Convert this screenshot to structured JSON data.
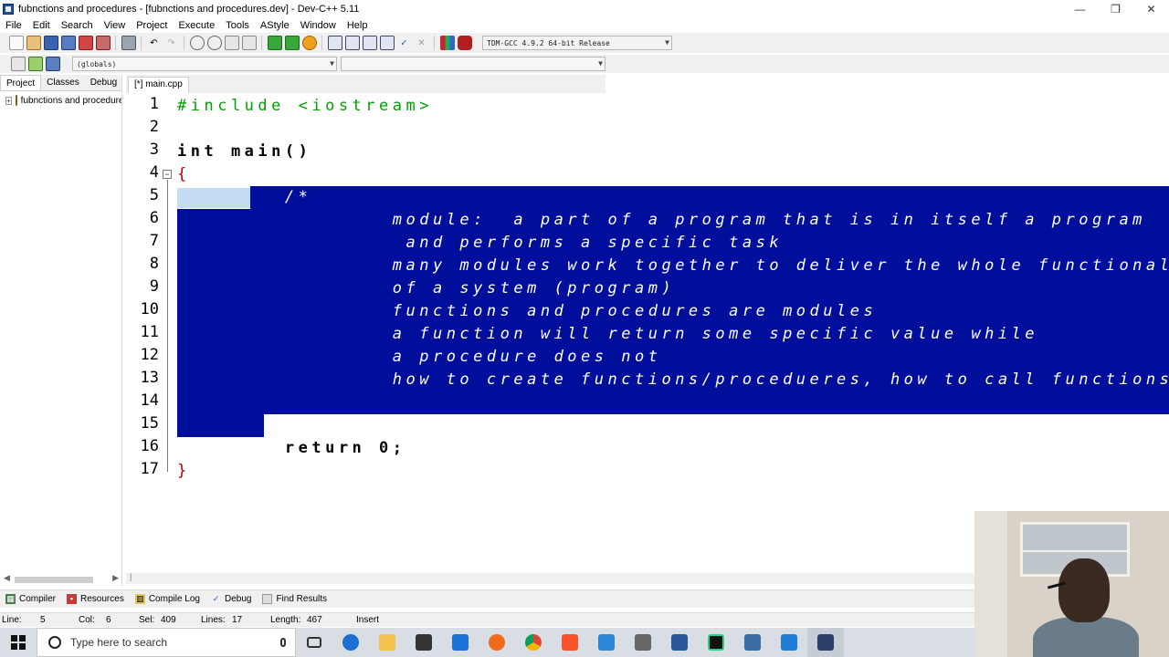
{
  "window": {
    "title": "fubnctions and procedures - [fubnctions and procedures.dev] - Dev-C++ 5.11",
    "minimize": "—",
    "maximize": "❐",
    "close": "✕"
  },
  "menu": [
    "File",
    "Edit",
    "Search",
    "View",
    "Project",
    "Execute",
    "Tools",
    "AStyle",
    "Window",
    "Help"
  ],
  "toolbar": {
    "compiler_select": "TDM-GCC 4.9.2 64-bit Release",
    "scope_select": "(globals)",
    "member_select": ""
  },
  "left_panel": {
    "tabs": [
      "Project",
      "Classes",
      "Debug"
    ],
    "active_tab": "Project",
    "project_name": "fubnctions and procedures"
  },
  "editor": {
    "tab_label": "[*] main.cpp",
    "line_numbers": [
      "1",
      "2",
      "3",
      "4",
      "5",
      "6",
      "7",
      "8",
      "9",
      "10",
      "11",
      "12",
      "13",
      "14",
      "15",
      "16",
      "17"
    ],
    "lines": [
      "#include <iostream>",
      "",
      "int main()",
      "{",
      "        /*",
      "                module:  a part of a program that is in itself a program",
      "                 and performs a specific task",
      "                many modules work together to deliver the whole functionality",
      "                of a system (program)",
      "                functions and procedures are modules",
      "                a function will return some specific value while",
      "                a procedure does not",
      "                how to create functions/procedueres, how to call functions/procedures",
      "",
      "        */",
      "        return 0;",
      "}"
    ],
    "code_colors": {
      "preprocessor": "#00a000",
      "brace": "#c00000",
      "number": "#7a3ec0",
      "selection": "#000e9c",
      "selected_text": "#ffffff"
    }
  },
  "bottom_tabs": [
    "Compiler",
    "Resources",
    "Compile Log",
    "Debug",
    "Find Results"
  ],
  "status": {
    "line_label": "Line:",
    "line_value": "5",
    "col_label": "Col:",
    "col_value": "6",
    "sel_label": "Sel:",
    "sel_value": "409",
    "lines_label": "Lines:",
    "lines_value": "17",
    "length_label": "Length:",
    "length_value": "467",
    "mode": "Insert"
  },
  "taskbar": {
    "search_placeholder": "Type here to search"
  }
}
